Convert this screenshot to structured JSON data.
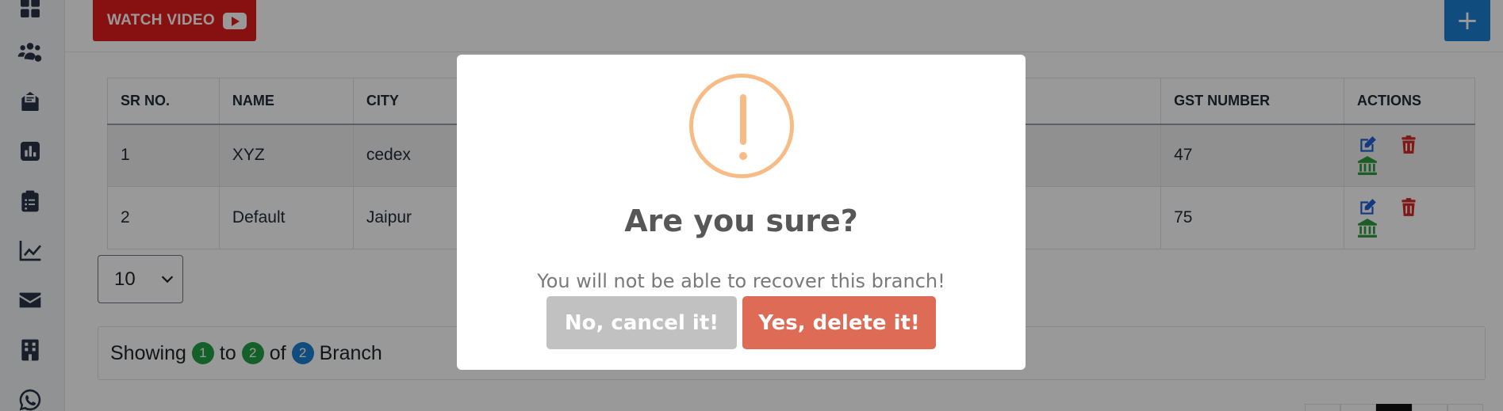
{
  "sidebar": {
    "icons": [
      "dashboard-icon",
      "users-settings-icon",
      "inbox-icon",
      "reports-icon",
      "clipboard-icon",
      "chart-line-icon",
      "mail-icon",
      "building-icon",
      "whatsapp-icon"
    ]
  },
  "topbar": {
    "watch_video_label": "WATCH VIDEO",
    "add_label": "+"
  },
  "table": {
    "headers": {
      "sr_no": "SR NO.",
      "name": "NAME",
      "city": "CITY",
      "gst_number": "GST NUMBER",
      "actions": "ACTIONS"
    },
    "rows": [
      {
        "sr_no": "1",
        "name": "XYZ",
        "city": "cedex",
        "gst_number": "47"
      },
      {
        "sr_no": "2",
        "name": "Default",
        "city": "Jaipur",
        "gst_number": "75"
      }
    ]
  },
  "pagination": {
    "page_size": "10",
    "showing_prefix": "Showing",
    "from": "1",
    "to_word": "to",
    "to": "2",
    "of_word": "of",
    "total": "2",
    "entity": "Branch"
  },
  "modal": {
    "title": "Are you sure?",
    "text": "You will not be able to recover this branch!",
    "cancel_label": "No, cancel it!",
    "confirm_label": "Yes, delete it!"
  },
  "colors": {
    "watch_video": "#e21b1b",
    "primary": "#1b7fd1",
    "warning_icon": "#f8bb86",
    "confirm_button": "#dd6b55",
    "cancel_button": "#c1c1c1",
    "edit_icon": "#1e5fd8",
    "delete_icon": "#d62828",
    "bank_icon": "#2e9b3e"
  }
}
